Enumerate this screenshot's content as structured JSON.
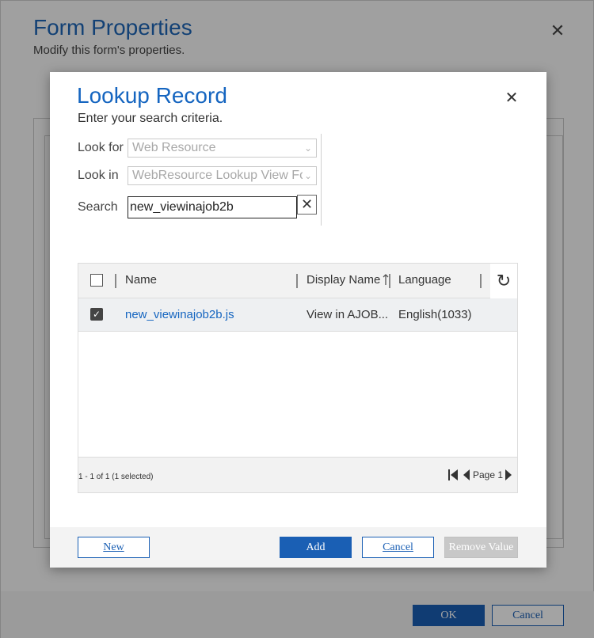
{
  "background_dialog": {
    "title": "Form Properties",
    "subtitle": "Modify this form's properties.",
    "close_icon": "close-icon",
    "ok_label": "OK",
    "cancel_label": "Cancel"
  },
  "lookup": {
    "title": "Lookup Record",
    "subtitle": "Enter your search criteria.",
    "close_icon": "close-icon",
    "fields": {
      "look_for_label": "Look for",
      "look_for_value": "Web Resource",
      "look_in_label": "Look in",
      "look_in_value": "WebResource Lookup View For",
      "search_label": "Search",
      "search_value": "new_viewinajob2b"
    },
    "grid": {
      "columns": [
        "Name",
        "Display Name",
        "Language"
      ],
      "sort_column": "Display Name",
      "rows": [
        {
          "selected": true,
          "name": "new_viewinajob2b.js",
          "display_name": "View in AJOB...",
          "language": "English(1033)"
        }
      ],
      "count_text": "1 - 1 of 1 (1 selected)",
      "page_label": "Page 1"
    },
    "buttons": {
      "new": "New",
      "add": "Add",
      "cancel": "Cancel",
      "remove_value": "Remove Value"
    }
  },
  "colors": {
    "accent": "#1a5fb4",
    "title_blue": "#1565c0",
    "disabled_button": "#c8c8c8"
  }
}
